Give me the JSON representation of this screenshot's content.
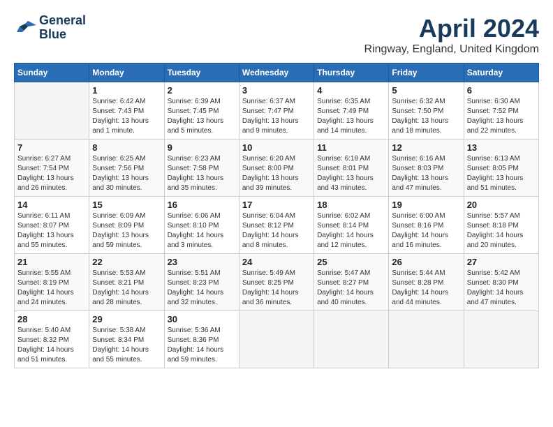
{
  "header": {
    "logo_line1": "General",
    "logo_line2": "Blue",
    "month_title": "April 2024",
    "location": "Ringway, England, United Kingdom"
  },
  "weekdays": [
    "Sunday",
    "Monday",
    "Tuesday",
    "Wednesday",
    "Thursday",
    "Friday",
    "Saturday"
  ],
  "weeks": [
    [
      {
        "day": "",
        "sunrise": "",
        "sunset": "",
        "daylight": ""
      },
      {
        "day": "1",
        "sunrise": "Sunrise: 6:42 AM",
        "sunset": "Sunset: 7:43 PM",
        "daylight": "Daylight: 13 hours and 1 minute."
      },
      {
        "day": "2",
        "sunrise": "Sunrise: 6:39 AM",
        "sunset": "Sunset: 7:45 PM",
        "daylight": "Daylight: 13 hours and 5 minutes."
      },
      {
        "day": "3",
        "sunrise": "Sunrise: 6:37 AM",
        "sunset": "Sunset: 7:47 PM",
        "daylight": "Daylight: 13 hours and 9 minutes."
      },
      {
        "day": "4",
        "sunrise": "Sunrise: 6:35 AM",
        "sunset": "Sunset: 7:49 PM",
        "daylight": "Daylight: 13 hours and 14 minutes."
      },
      {
        "day": "5",
        "sunrise": "Sunrise: 6:32 AM",
        "sunset": "Sunset: 7:50 PM",
        "daylight": "Daylight: 13 hours and 18 minutes."
      },
      {
        "day": "6",
        "sunrise": "Sunrise: 6:30 AM",
        "sunset": "Sunset: 7:52 PM",
        "daylight": "Daylight: 13 hours and 22 minutes."
      }
    ],
    [
      {
        "day": "7",
        "sunrise": "Sunrise: 6:27 AM",
        "sunset": "Sunset: 7:54 PM",
        "daylight": "Daylight: 13 hours and 26 minutes."
      },
      {
        "day": "8",
        "sunrise": "Sunrise: 6:25 AM",
        "sunset": "Sunset: 7:56 PM",
        "daylight": "Daylight: 13 hours and 30 minutes."
      },
      {
        "day": "9",
        "sunrise": "Sunrise: 6:23 AM",
        "sunset": "Sunset: 7:58 PM",
        "daylight": "Daylight: 13 hours and 35 minutes."
      },
      {
        "day": "10",
        "sunrise": "Sunrise: 6:20 AM",
        "sunset": "Sunset: 8:00 PM",
        "daylight": "Daylight: 13 hours and 39 minutes."
      },
      {
        "day": "11",
        "sunrise": "Sunrise: 6:18 AM",
        "sunset": "Sunset: 8:01 PM",
        "daylight": "Daylight: 13 hours and 43 minutes."
      },
      {
        "day": "12",
        "sunrise": "Sunrise: 6:16 AM",
        "sunset": "Sunset: 8:03 PM",
        "daylight": "Daylight: 13 hours and 47 minutes."
      },
      {
        "day": "13",
        "sunrise": "Sunrise: 6:13 AM",
        "sunset": "Sunset: 8:05 PM",
        "daylight": "Daylight: 13 hours and 51 minutes."
      }
    ],
    [
      {
        "day": "14",
        "sunrise": "Sunrise: 6:11 AM",
        "sunset": "Sunset: 8:07 PM",
        "daylight": "Daylight: 13 hours and 55 minutes."
      },
      {
        "day": "15",
        "sunrise": "Sunrise: 6:09 AM",
        "sunset": "Sunset: 8:09 PM",
        "daylight": "Daylight: 13 hours and 59 minutes."
      },
      {
        "day": "16",
        "sunrise": "Sunrise: 6:06 AM",
        "sunset": "Sunset: 8:10 PM",
        "daylight": "Daylight: 14 hours and 3 minutes."
      },
      {
        "day": "17",
        "sunrise": "Sunrise: 6:04 AM",
        "sunset": "Sunset: 8:12 PM",
        "daylight": "Daylight: 14 hours and 8 minutes."
      },
      {
        "day": "18",
        "sunrise": "Sunrise: 6:02 AM",
        "sunset": "Sunset: 8:14 PM",
        "daylight": "Daylight: 14 hours and 12 minutes."
      },
      {
        "day": "19",
        "sunrise": "Sunrise: 6:00 AM",
        "sunset": "Sunset: 8:16 PM",
        "daylight": "Daylight: 14 hours and 16 minutes."
      },
      {
        "day": "20",
        "sunrise": "Sunrise: 5:57 AM",
        "sunset": "Sunset: 8:18 PM",
        "daylight": "Daylight: 14 hours and 20 minutes."
      }
    ],
    [
      {
        "day": "21",
        "sunrise": "Sunrise: 5:55 AM",
        "sunset": "Sunset: 8:19 PM",
        "daylight": "Daylight: 14 hours and 24 minutes."
      },
      {
        "day": "22",
        "sunrise": "Sunrise: 5:53 AM",
        "sunset": "Sunset: 8:21 PM",
        "daylight": "Daylight: 14 hours and 28 minutes."
      },
      {
        "day": "23",
        "sunrise": "Sunrise: 5:51 AM",
        "sunset": "Sunset: 8:23 PM",
        "daylight": "Daylight: 14 hours and 32 minutes."
      },
      {
        "day": "24",
        "sunrise": "Sunrise: 5:49 AM",
        "sunset": "Sunset: 8:25 PM",
        "daylight": "Daylight: 14 hours and 36 minutes."
      },
      {
        "day": "25",
        "sunrise": "Sunrise: 5:47 AM",
        "sunset": "Sunset: 8:27 PM",
        "daylight": "Daylight: 14 hours and 40 minutes."
      },
      {
        "day": "26",
        "sunrise": "Sunrise: 5:44 AM",
        "sunset": "Sunset: 8:28 PM",
        "daylight": "Daylight: 14 hours and 44 minutes."
      },
      {
        "day": "27",
        "sunrise": "Sunrise: 5:42 AM",
        "sunset": "Sunset: 8:30 PM",
        "daylight": "Daylight: 14 hours and 47 minutes."
      }
    ],
    [
      {
        "day": "28",
        "sunrise": "Sunrise: 5:40 AM",
        "sunset": "Sunset: 8:32 PM",
        "daylight": "Daylight: 14 hours and 51 minutes."
      },
      {
        "day": "29",
        "sunrise": "Sunrise: 5:38 AM",
        "sunset": "Sunset: 8:34 PM",
        "daylight": "Daylight: 14 hours and 55 minutes."
      },
      {
        "day": "30",
        "sunrise": "Sunrise: 5:36 AM",
        "sunset": "Sunset: 8:36 PM",
        "daylight": "Daylight: 14 hours and 59 minutes."
      },
      {
        "day": "",
        "sunrise": "",
        "sunset": "",
        "daylight": ""
      },
      {
        "day": "",
        "sunrise": "",
        "sunset": "",
        "daylight": ""
      },
      {
        "day": "",
        "sunrise": "",
        "sunset": "",
        "daylight": ""
      },
      {
        "day": "",
        "sunrise": "",
        "sunset": "",
        "daylight": ""
      }
    ]
  ]
}
